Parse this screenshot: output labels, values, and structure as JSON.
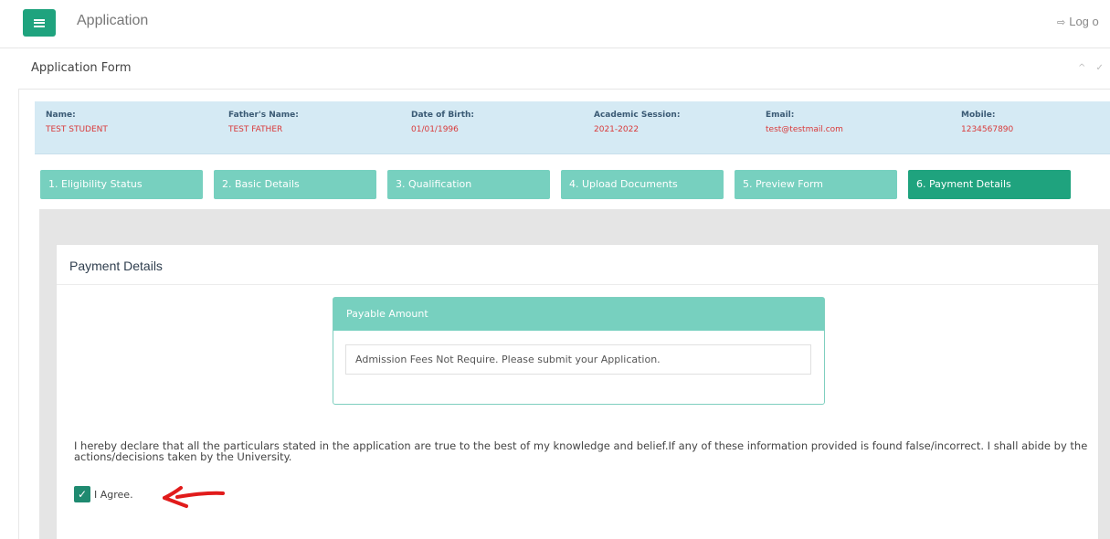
{
  "header": {
    "app_title": "Application",
    "logout_label": "Log o",
    "menu_icon": "hamburger-icon",
    "logout_icon": "sign-out-icon"
  },
  "panel": {
    "title": "Application Form",
    "tools": "^ ✓"
  },
  "student_info": [
    {
      "label": "Name:",
      "value": "TEST STUDENT"
    },
    {
      "label": "Father's Name:",
      "value": "TEST FATHER"
    },
    {
      "label": "Date of Birth:",
      "value": "01/01/1996"
    },
    {
      "label": "Academic Session:",
      "value": "2021-2022"
    },
    {
      "label": "Email:",
      "value": "test@testmail.com"
    },
    {
      "label": "Mobile:",
      "value": "1234567890"
    }
  ],
  "tabs": [
    {
      "label": "1. Eligibility Status",
      "active": false
    },
    {
      "label": "2. Basic Details",
      "active": false
    },
    {
      "label": "3. Qualification",
      "active": false
    },
    {
      "label": "4. Upload Documents",
      "active": false
    },
    {
      "label": "5. Preview Form",
      "active": false
    },
    {
      "label": "6. Payment Details",
      "active": true
    }
  ],
  "payment": {
    "card_title": "Payment Details",
    "panel_heading": "Payable Amount",
    "message": "Admission Fees Not Require. Please submit your Application."
  },
  "declaration": {
    "text": "I hereby declare that all the particulars stated in the application are true to the best of my knowledge and belief.If any of these information provided is found false/incorrect. I shall abide by the actions/decisions taken by the University.",
    "agree_label": "I Agree.",
    "checked": true
  },
  "colors": {
    "brand_green": "#1fa37e",
    "tab_light": "#77d0bf",
    "info_bg": "#d5eaf4",
    "value_red": "#d93a3a",
    "annotation_red": "#e11b1b"
  }
}
